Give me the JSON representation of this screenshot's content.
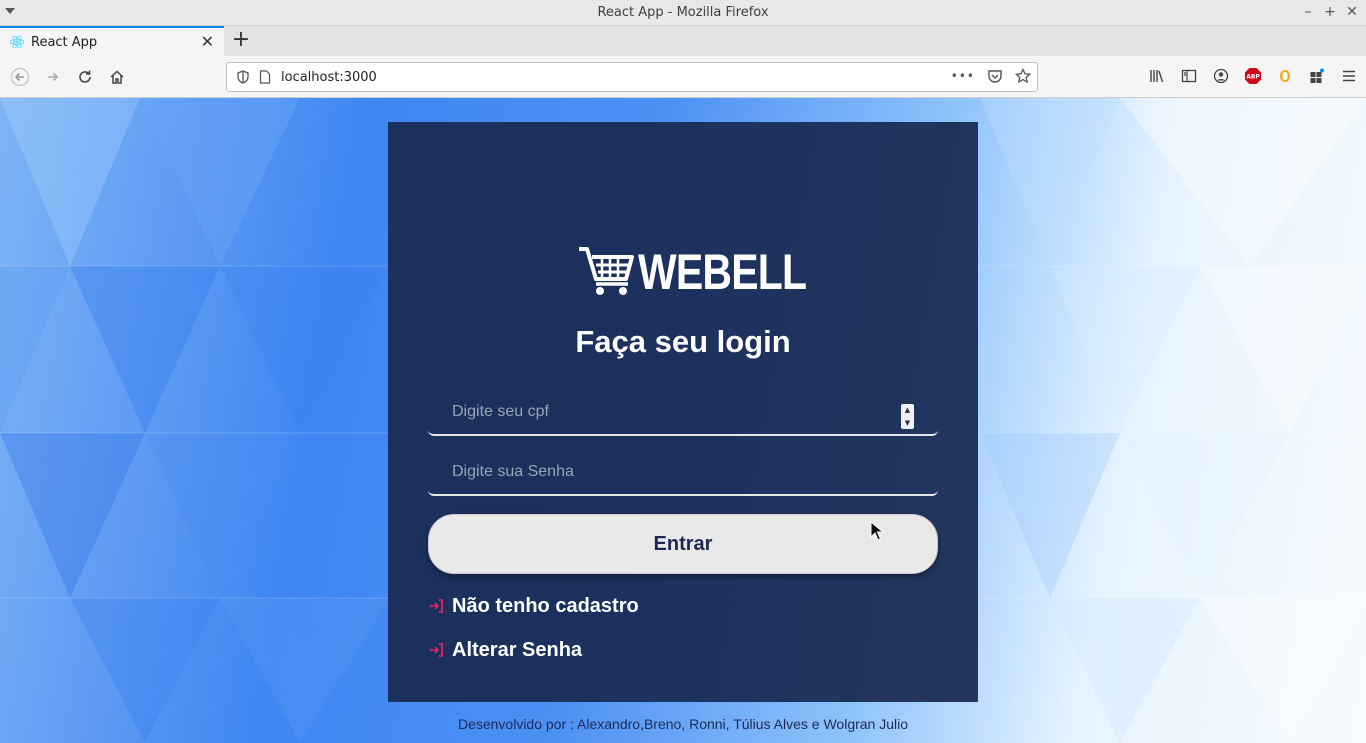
{
  "window": {
    "title": "React App - Mozilla Firefox",
    "controls": [
      "–",
      "+",
      "✕"
    ]
  },
  "tabs": [
    {
      "label": "React App",
      "favicon": "react-icon",
      "active": true
    }
  ],
  "newtab_label": "+",
  "navbar": {
    "url": "localhost:3000",
    "more_label": "•••"
  },
  "login": {
    "brand": "WEBELL",
    "title": "Faça seu login",
    "cpf_placeholder": "Digite seu cpf",
    "password_placeholder": "Digite sua Senha",
    "submit_label": "Entrar",
    "links": {
      "register": "Não tenho cadastro",
      "change_password": "Alterar Senha"
    }
  },
  "footer": {
    "credits": "Desenvolvido por : Alexandro,Breno, Ronni, Túlius Alves e Wolgran Julio"
  },
  "colors": {
    "card_bg": "#182850",
    "link_icon": "#e0245e",
    "accent_tab": "#0a84ff",
    "button_text": "#1c2752"
  }
}
